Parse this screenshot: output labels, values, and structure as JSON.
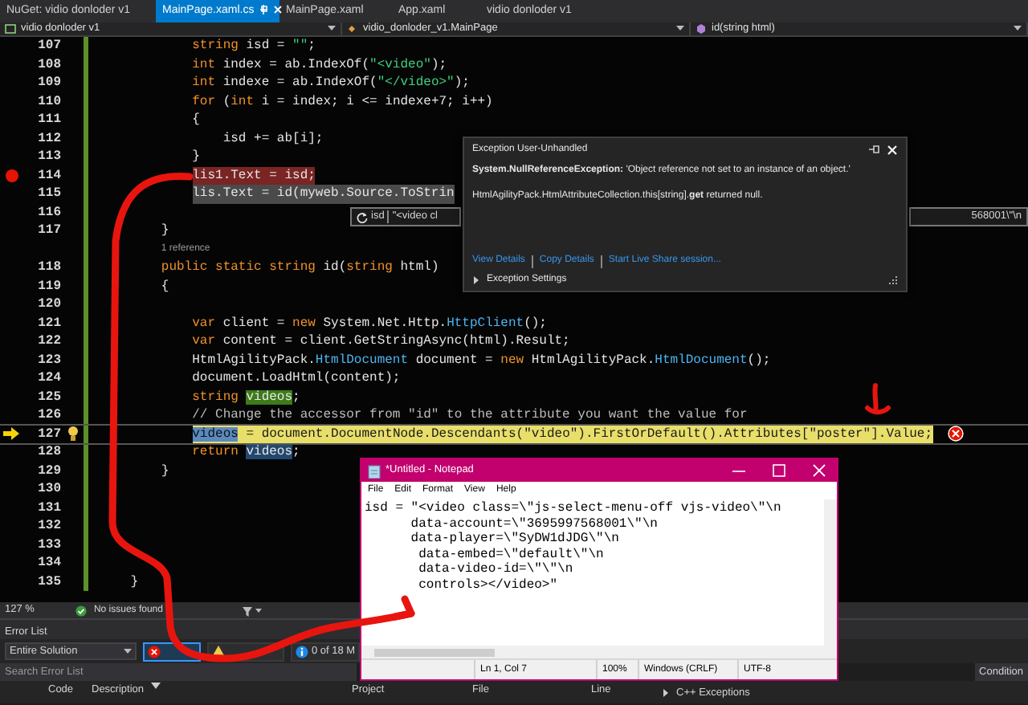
{
  "tabs": [
    {
      "label": "NuGet: vidio donloder v1",
      "selected": false
    },
    {
      "label": "MainPage.xaml.cs",
      "selected": true
    },
    {
      "label": "MainPage.xaml",
      "selected": false
    },
    {
      "label": "App.xaml",
      "selected": false
    },
    {
      "label": "vidio donloder v1",
      "selected": false
    }
  ],
  "navigation_bar": {
    "project": "vidio donloder v1",
    "class": "vidio_donloder_v1.MainPage",
    "member": "id(string html)"
  },
  "code_lines": [
    {
      "number": "107",
      "kind": "plain",
      "tokens": [
        {
          "kind": "kw",
          "text": "            string"
        },
        {
          "kind": "p",
          "text": " isd = "
        },
        {
          "kind": "str",
          "text": "\"\""
        },
        {
          "kind": "p",
          "text": ";"
        }
      ]
    },
    {
      "number": "108",
      "kind": "plain",
      "tokens": [
        {
          "kind": "kw",
          "text": "            int"
        },
        {
          "kind": "p",
          "text": " index = ab.IndexOf("
        },
        {
          "kind": "str",
          "text": "\"<video\""
        },
        {
          "kind": "p",
          "text": ");"
        }
      ]
    },
    {
      "number": "109",
      "kind": "plain",
      "tokens": [
        {
          "kind": "kw",
          "text": "            int"
        },
        {
          "kind": "p",
          "text": " indexe = ab.IndexOf("
        },
        {
          "kind": "str",
          "text": "\"</video>\""
        },
        {
          "kind": "p",
          "text": ");"
        }
      ]
    },
    {
      "number": "110",
      "kind": "plain",
      "tokens": [
        {
          "kind": "kw",
          "text": "            for"
        },
        {
          "kind": "p",
          "text": " ("
        },
        {
          "kind": "kw",
          "text": "int"
        },
        {
          "kind": "p",
          "text": " i = index; i <= indexe+7; i++)"
        }
      ]
    },
    {
      "number": "111",
      "kind": "plain",
      "tokens": [
        {
          "kind": "p",
          "text": "            {"
        }
      ]
    },
    {
      "number": "112",
      "kind": "plain",
      "tokens": [
        {
          "kind": "p",
          "text": "                isd += ab[i];"
        }
      ]
    },
    {
      "number": "113",
      "kind": "plain",
      "tokens": [
        {
          "kind": "p",
          "text": "            }"
        }
      ]
    },
    {
      "number": "114",
      "kind": "breakpoint",
      "tokens": [
        {
          "kind": "p",
          "text": "            lis1.Text = isd;"
        }
      ]
    },
    {
      "number": "115",
      "kind": "selection",
      "tokens": [
        {
          "kind": "p",
          "text": "            lis.Text = id(myweb.Source.ToStrin"
        }
      ]
    },
    {
      "number": "116",
      "kind": "plain"
    },
    {
      "number": "117",
      "kind": "plain",
      "tokens": [
        {
          "kind": "p",
          "text": "        }"
        }
      ]
    },
    {
      "kind": "codelens",
      "tokens": [
        {
          "kind": "lens",
          "text": "        1 reference"
        }
      ]
    },
    {
      "number": "118",
      "kind": "plain",
      "tokens": [
        {
          "kind": "kw",
          "text": "        public static string"
        },
        {
          "kind": "p",
          "text": " id("
        },
        {
          "kind": "kw",
          "text": "string"
        },
        {
          "kind": "p",
          "text": " html)"
        }
      ]
    },
    {
      "number": "119",
      "kind": "plain",
      "tokens": [
        {
          "kind": "p",
          "text": "        {"
        }
      ]
    },
    {
      "number": "120",
      "kind": "plain"
    },
    {
      "number": "121",
      "kind": "plain",
      "tokens": [
        {
          "kind": "kw",
          "text": "            var"
        },
        {
          "kind": "p",
          "text": " client = "
        },
        {
          "kind": "kw",
          "text": "new"
        },
        {
          "kind": "p",
          "text": " System.Net.Http."
        },
        {
          "kind": "type",
          "text": "HttpClient"
        },
        {
          "kind": "p",
          "text": "();"
        }
      ]
    },
    {
      "number": "122",
      "kind": "plain",
      "tokens": [
        {
          "kind": "kw",
          "text": "            var"
        },
        {
          "kind": "p",
          "text": " content = client.GetStringAsync(html).Result;"
        }
      ]
    },
    {
      "number": "123",
      "kind": "plain",
      "tokens": [
        {
          "kind": "p",
          "text": "            HtmlAgilityPack."
        },
        {
          "kind": "type",
          "text": "HtmlDocument"
        },
        {
          "kind": "p",
          "text": " document = "
        },
        {
          "kind": "kw",
          "text": "new"
        },
        {
          "kind": "p",
          "text": " HtmlAgilityPack."
        },
        {
          "kind": "type",
          "text": "HtmlDocument"
        },
        {
          "kind": "p",
          "text": "();"
        }
      ]
    },
    {
      "number": "124",
      "kind": "plain",
      "tokens": [
        {
          "kind": "p",
          "text": "            document.LoadHtml(content);"
        }
      ]
    },
    {
      "number": "125",
      "kind": "plain",
      "tokens": [
        {
          "kind": "kw",
          "text": "            string "
        },
        {
          "kind": "refdef",
          "text": "videos"
        },
        {
          "kind": "p",
          "text": ";"
        }
      ]
    },
    {
      "number": "126",
      "kind": "plain",
      "tokens": [
        {
          "kind": "comment",
          "text": "            // Change the accessor from \"id\" to the attribute you want the value for"
        }
      ]
    },
    {
      "number": "127",
      "kind": "current",
      "tokens": [
        {
          "kind": "ref",
          "text": "            videos"
        },
        {
          "kind": "p",
          "text": " = document.DocumentNode.Descendants("
        },
        {
          "kind": "str",
          "text": "\"video\""
        },
        {
          "kind": "p",
          "text": ").FirstOrDefault().Attributes["
        },
        {
          "kind": "str",
          "text": "\"poster\""
        },
        {
          "kind": "p",
          "text": "].Value;"
        }
      ]
    },
    {
      "number": "128",
      "kind": "plain",
      "tokens": [
        {
          "kind": "kw",
          "text": "            return "
        },
        {
          "kind": "ref",
          "text": "videos"
        },
        {
          "kind": "p",
          "text": ";"
        }
      ]
    },
    {
      "number": "129",
      "kind": "plain",
      "tokens": [
        {
          "kind": "p",
          "text": "        }"
        }
      ]
    },
    {
      "number": "130",
      "kind": "plain"
    },
    {
      "number": "131",
      "kind": "plain"
    },
    {
      "number": "132",
      "kind": "plain"
    },
    {
      "number": "133",
      "kind": "plain"
    },
    {
      "number": "134",
      "kind": "plain"
    },
    {
      "number": "135",
      "kind": "plain",
      "tokens": [
        {
          "kind": "p",
          "text": "    }"
        }
      ]
    }
  ],
  "data_tip": {
    "name": "isd",
    "value_start": "\"<video cl",
    "value_end": "568001\\\"\\n"
  },
  "exception_popup": {
    "title": "Exception User-Unhandled",
    "messages": [
      "**System.NullReferenceException:** 'Object reference not set to an instance of an object.'",
      "HtmlAgilityPack.HtmlAttributeCollection.this[string].**get** returned null."
    ],
    "links": [
      "View Details",
      "Copy Details",
      "Start Live Share session..."
    ],
    "settings": {
      "label": "Exception Settings",
      "expanded": false
    }
  },
  "status_bar": {
    "zoom": "127 %",
    "issues": "No issues found"
  },
  "error_list": {
    "title": "Error List",
    "scope": "Entire Solution",
    "messages": "0 of 18 M",
    "search": {
      "placeholder": "Search Error List"
    },
    "condition": "Condition",
    "columns": [
      "Code",
      "Description",
      "Project",
      "File",
      "Line"
    ],
    "side_panel": "C++ Exceptions"
  },
  "notepad": {
    "title": "*Untitled - Notepad",
    "menus": [
      "File",
      "Edit",
      "Format",
      "View",
      "Help"
    ],
    "text": "isd = \"<video class=\\\"js-select-menu-off vjs-video\\\"\\n\n      data-account=\\\"3695997568001\\\"\\n\n      data-player=\\\"SyDW1dJDG\\\"\\n\n       data-embed=\\\"default\\\"\\n\n       data-video-id=\\\"\\\"\\n\n       controls></video>\"",
    "status": [
      "Ln 1, Col 7",
      "100%",
      "Windows (CRLF)",
      "UTF-8"
    ]
  }
}
